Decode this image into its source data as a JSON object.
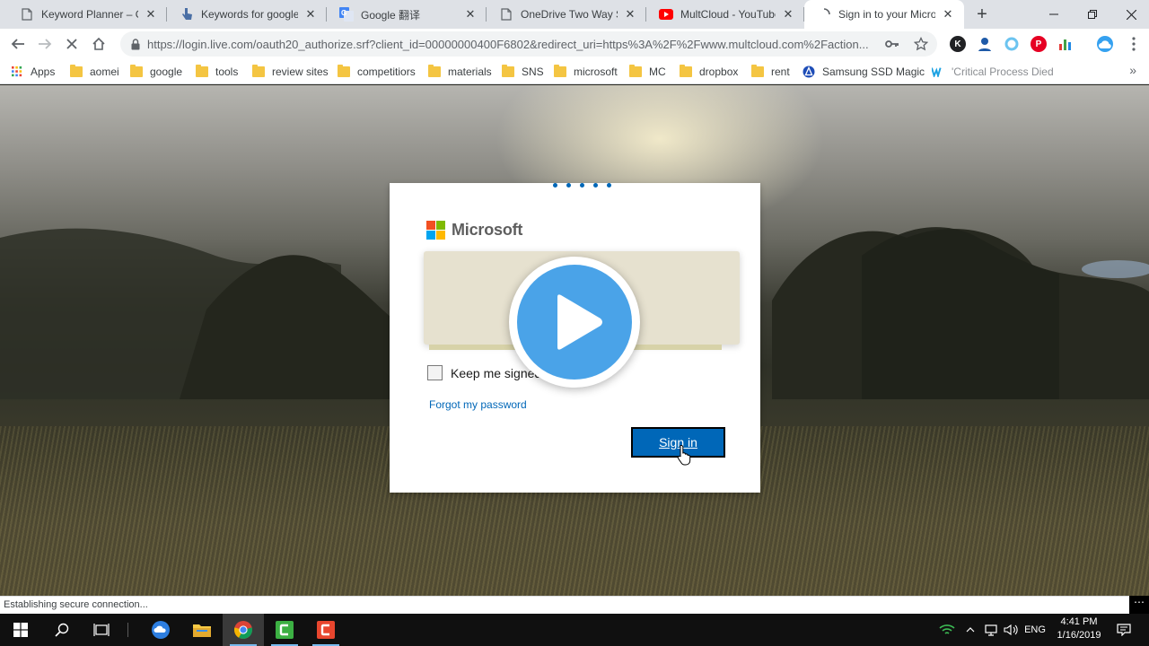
{
  "browser": {
    "tabs": [
      {
        "title": "Keyword Planner – Goo",
        "favicon": "page-icon",
        "active": false
      },
      {
        "title": "Keywords for google pl",
        "favicon": "cursor-hand-icon",
        "active": false
      },
      {
        "title": "Google 翻译",
        "favicon": "google-translate-icon",
        "active": false
      },
      {
        "title": "OneDrive Two Way Sync",
        "favicon": "page-icon",
        "active": false
      },
      {
        "title": "MultCloud - YouTube",
        "favicon": "youtube-icon",
        "active": false
      },
      {
        "title": "Sign in to your Microso",
        "favicon": "loading-spinner-icon",
        "active": true
      }
    ],
    "close_glyph": "✕",
    "new_tab_glyph": "+",
    "url": "https://login.live.com/oauth20_authorize.srf?client_id=00000000400F6802&redirect_uri=https%3A%2F%2Fwww.multcloud.com%2Faction..."
  },
  "bookmarks": [
    {
      "label": "Apps",
      "icon": "apps-grid-icon"
    },
    {
      "label": "aomei",
      "icon": "folder-icon"
    },
    {
      "label": "google",
      "icon": "folder-icon"
    },
    {
      "label": "tools",
      "icon": "folder-icon"
    },
    {
      "label": "review sites",
      "icon": "folder-icon"
    },
    {
      "label": "competitiors",
      "icon": "folder-icon"
    },
    {
      "label": "materials",
      "icon": "folder-icon"
    },
    {
      "label": "SNS",
      "icon": "folder-icon"
    },
    {
      "label": "microsoft",
      "icon": "folder-icon"
    },
    {
      "label": "MC",
      "icon": "folder-icon"
    },
    {
      "label": "dropbox",
      "icon": "folder-icon"
    },
    {
      "label": "rent",
      "icon": "folder-icon"
    },
    {
      "label": "Samsung SSD Magic",
      "icon": "samsung-icon"
    },
    {
      "label": "'Critical Process Died",
      "icon": "w-site-icon"
    }
  ],
  "login": {
    "brand": "Microsoft",
    "keep_signed_in": "Keep me signed",
    "forgot_password": "Forgot my password",
    "sign_in": "Sign in"
  },
  "status_text": "Establishing secure connection...",
  "status_ellipsis": "⋯",
  "taskbar": {
    "language": "ENG",
    "time": "4:41 PM",
    "date": "1/16/2019"
  },
  "colors": {
    "ms_blue": "#0067b8",
    "play_blue": "#4aa3e8",
    "ms_red": "#f25022",
    "ms_green": "#7fba00",
    "ms_blue_tile": "#00a4ef",
    "ms_yellow": "#ffb900"
  }
}
